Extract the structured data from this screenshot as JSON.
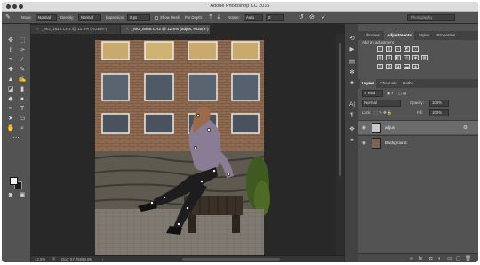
{
  "window": {
    "title": "Adobe Photoshop CC 2015"
  },
  "options_bar": {
    "mode_label": "Mode:",
    "mode_value": "Normal",
    "density_label": "Density:",
    "density_value": "Normal",
    "expansion_label": "Expansion:",
    "expansion_value": "0 px",
    "show_mesh_label": "Show Mesh",
    "pin_depth_label": "Pin Depth:",
    "rotate_label": "Rotate:",
    "rotate_value": "Auto",
    "rotate_degrees": "0",
    "workspace": "Photography"
  },
  "document_tabs": [
    {
      "label": "_MG_2612.CR2 @ 12.5% (RGB/8*)",
      "active": false
    },
    {
      "label": "_MG_6468.CR2 @ 12.5% (adjus, RGB/8*)",
      "active": true
    }
  ],
  "status_bar": {
    "zoom": "12.5%",
    "doc_info": "Doc: 57.7M/69.9M"
  },
  "right_tabs_top": [
    {
      "label": "Libraries",
      "active": false
    },
    {
      "label": "Adjustments",
      "active": true
    },
    {
      "label": "Styles",
      "active": false
    },
    {
      "label": "Properties",
      "active": false
    }
  ],
  "adjustments": {
    "header": "Add an adjustment"
  },
  "right_tabs_bottom": [
    {
      "label": "Layers",
      "active": true
    },
    {
      "label": "Channels",
      "active": false
    },
    {
      "label": "Paths",
      "active": false
    }
  ],
  "layers_panel": {
    "kind_filter": "Kind",
    "blend_mode": "Normal",
    "opacity_label": "Opacity:",
    "opacity_value": "100%",
    "lock_label": "Lock:",
    "fill_label": "Fill:",
    "fill_value": "100%",
    "layers": [
      {
        "name": "adjus",
        "selected": true
      },
      {
        "name": "Background",
        "selected": false
      }
    ]
  },
  "colors": {
    "app_bg": "#323232",
    "panel": "#535353",
    "selected_layer": "#6b6b6b"
  }
}
